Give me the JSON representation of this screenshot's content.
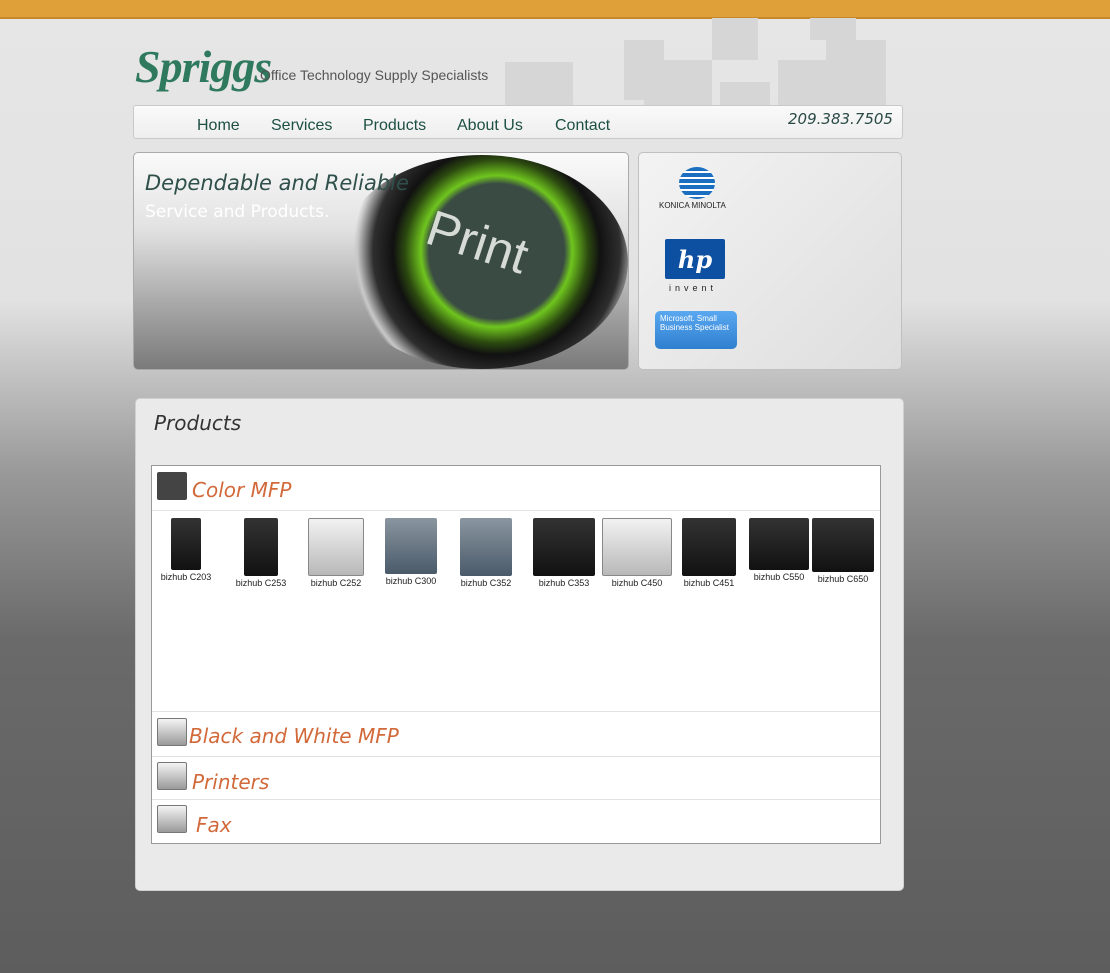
{
  "header": {
    "logo": "Spriggs",
    "tagline": "Office Technology Supply Specialists",
    "phone": "209.383.7505"
  },
  "nav": {
    "items": [
      {
        "label": "Home"
      },
      {
        "label": "Services"
      },
      {
        "label": "Products"
      },
      {
        "label": "About Us"
      },
      {
        "label": "Contact"
      }
    ]
  },
  "hero": {
    "headline": "Dependable and Reliable",
    "subline": "Service and Products.",
    "button_text": "Print"
  },
  "partners": {
    "konica": "KONICA MINOLTA",
    "hp": "hp",
    "hp_tagline": "invent",
    "microsoft": "Microsoft. Small Business Specialist"
  },
  "products": {
    "title": "Products",
    "sections": [
      {
        "label": "Color MFP"
      },
      {
        "label": "Black and White MFP"
      },
      {
        "label": "Printers"
      },
      {
        "label": "Fax"
      }
    ],
    "color_mfp_items": [
      {
        "name": "bizhub C203"
      },
      {
        "name": "bizhub C253"
      },
      {
        "name": "bizhub C252"
      },
      {
        "name": "bizhub C300"
      },
      {
        "name": "bizhub C352"
      },
      {
        "name": "bizhub C353"
      },
      {
        "name": "bizhub C450"
      },
      {
        "name": "bizhub C451"
      },
      {
        "name": "bizhub C550"
      },
      {
        "name": "bizhub C650"
      }
    ]
  },
  "colors": {
    "top_bar": "#dfa03a",
    "brand_green": "#2f7a5e",
    "section_orange": "#d2693a",
    "nav_text": "#1d4f43"
  }
}
